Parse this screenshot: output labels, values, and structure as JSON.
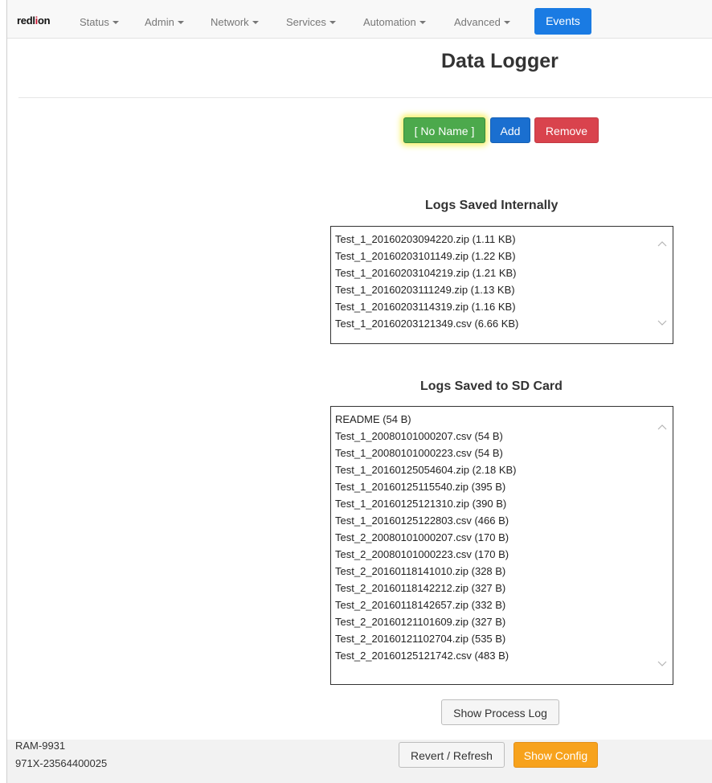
{
  "navbar": {
    "brand": {
      "part1": "red",
      "part2": "l",
      "part3": "i",
      "part4": "on"
    },
    "items": [
      {
        "label": "Status"
      },
      {
        "label": "Admin"
      },
      {
        "label": "Network"
      },
      {
        "label": "Services"
      },
      {
        "label": "Automation"
      },
      {
        "label": "Advanced"
      }
    ],
    "active": {
      "label": "Events"
    }
  },
  "page": {
    "title": "Data Logger"
  },
  "logger_controls": {
    "selected_label": "[ No Name ]",
    "add_label": "Add",
    "remove_label": "Remove"
  },
  "logs_internal": {
    "title": "Logs Saved Internally",
    "items": [
      "Test_1_20160203094220.zip (1.11 KB)",
      "Test_1_20160203101149.zip (1.22 KB)",
      "Test_1_20160203104219.zip (1.21 KB)",
      "Test_1_20160203111249.zip (1.13 KB)",
      "Test_1_20160203114319.zip (1.16 KB)",
      "Test_1_20160203121349.csv (6.66 KB)"
    ]
  },
  "logs_sd": {
    "title": "Logs Saved to SD Card",
    "items": [
      "README (54 B)",
      "Test_1_20080101000207.csv (54 B)",
      "Test_1_20080101000223.csv (54 B)",
      "Test_1_20160125054604.zip (2.18 KB)",
      "Test_1_20160125115540.zip (395 B)",
      "Test_1_20160125121310.zip (390 B)",
      "Test_1_20160125122803.csv (466 B)",
      "Test_2_20080101000207.csv (170 B)",
      "Test_2_20080101000223.csv (170 B)",
      "Test_2_20160118141010.zip (328 B)",
      "Test_2_20160118142212.zip (327 B)",
      "Test_2_20160118142657.zip (332 B)",
      "Test_2_20160121101609.zip (327 B)",
      "Test_2_20160121102704.zip (535 B)",
      "Test_2_20160125121742.csv (483 B)"
    ]
  },
  "process_log_label": "Show Process Log",
  "footer": {
    "model": "RAM-9931",
    "serial": "971X-23564400025",
    "revert_label": "Revert / Refresh",
    "show_config_label": "Show Config"
  },
  "colors": {
    "primary": "#1a7be3",
    "success": "#4ca94c",
    "danger": "#d9434d",
    "warning": "#f7a21c",
    "highlight_glow": "#f7f060",
    "brand_red": "#c8102e"
  }
}
